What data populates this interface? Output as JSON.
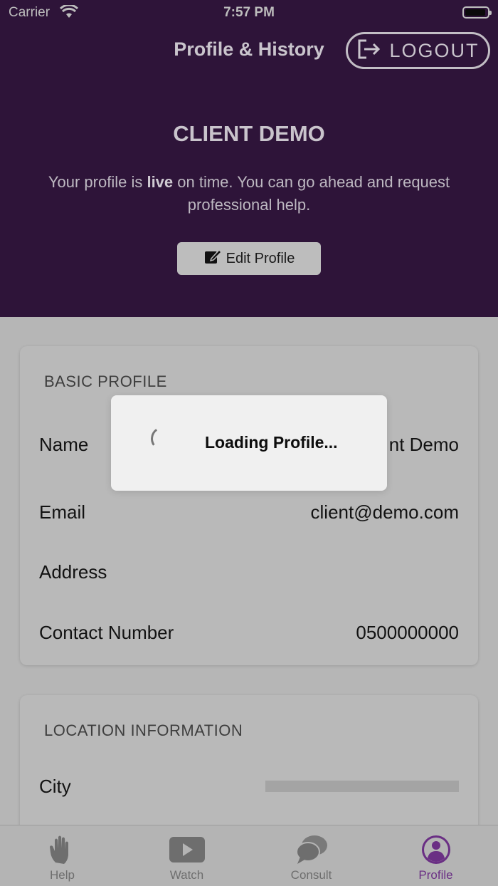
{
  "status_bar": {
    "carrier": "Carrier",
    "time": "7:57 PM"
  },
  "header": {
    "title": "Profile & History",
    "logout_label": "LOGOUT",
    "client_name": "CLIENT DEMO",
    "message_before": "Your profile is ",
    "message_bold": "live",
    "message_after": " on time. You can go ahead and request professional help.",
    "edit_label": "Edit Profile"
  },
  "basic_profile": {
    "title": "BASIC PROFILE",
    "name_label": "Name",
    "name_value": "nt Demo",
    "email_label": "Email",
    "email_value": "client@demo.com",
    "address_label": "Address",
    "address_value": "",
    "contact_label": "Contact Number",
    "contact_value": "0500000000"
  },
  "location_info": {
    "title": "LOCATION INFORMATION",
    "city_label": "City"
  },
  "loading": {
    "text": "Loading Profile..."
  },
  "tabs": [
    {
      "label": "Help",
      "icon": "hand-icon"
    },
    {
      "label": "Watch",
      "icon": "play-icon"
    },
    {
      "label": "Consult",
      "icon": "chat-bubbles-icon"
    },
    {
      "label": "Profile",
      "icon": "user-circle-icon",
      "active": true
    }
  ],
  "colors": {
    "header_bg": "#2e1439",
    "accent": "#6a2f84",
    "overlay_bg": "#b6b6b6"
  }
}
